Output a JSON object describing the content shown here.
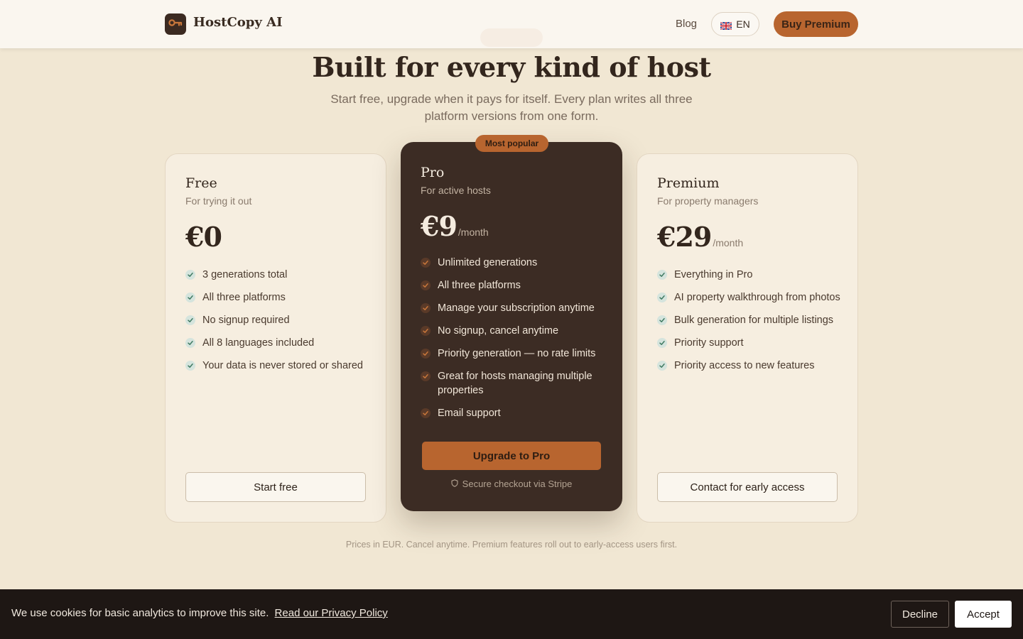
{
  "header": {
    "brand": "HostCopy AI",
    "logo_icon": "key-icon",
    "nav_blog": "Blog",
    "language": "EN",
    "language_flag": "uk-flag-icon",
    "buy_premium": "Buy Premium"
  },
  "hero": {
    "title": "Built for every kind of host",
    "subtitle": "Start free, upgrade when it pays for itself. Every plan writes all three platform versions from one form."
  },
  "plans": {
    "free": {
      "name": "Free",
      "tagline": "For trying it out",
      "price": "€0",
      "period": "",
      "features": [
        "3 generations total",
        "All three platforms",
        "No signup required",
        "All 8 languages included",
        "Your data is never stored or shared"
      ],
      "cta": "Start free"
    },
    "pro": {
      "badge": "Most popular",
      "name": "Pro",
      "tagline": "For active hosts",
      "price": "€9",
      "period": "/month",
      "features": [
        "Unlimited generations",
        "All three platforms",
        "Manage your subscription anytime",
        "No signup, cancel anytime",
        "Priority generation — no rate limits",
        "Great for hosts managing multiple properties",
        "Email support"
      ],
      "cta": "Upgrade to Pro",
      "secure_note": "Secure checkout via Stripe"
    },
    "premium": {
      "name": "Premium",
      "tagline": "For property managers",
      "price": "€29",
      "period": "/month",
      "features": [
        "Everything in Pro",
        "AI property walkthrough from photos",
        "Bulk generation for multiple listings",
        "Priority support",
        "Priority access to new features"
      ],
      "cta": "Contact for early access"
    }
  },
  "footnote": "Prices in EUR. Cancel anytime. Premium features roll out to early-access users first.",
  "cookie": {
    "text": "We use cookies for basic analytics to improve this site.",
    "link": "Read our Privacy Policy",
    "decline": "Decline",
    "accept": "Accept"
  },
  "colors": {
    "page_bg": "#f1e7d3",
    "accent": "#b8652f",
    "dark_card": "#3c2c24",
    "check_light": "#3f7a62",
    "check_dark": "#c9773b",
    "cookie_bg": "#1e1714"
  }
}
